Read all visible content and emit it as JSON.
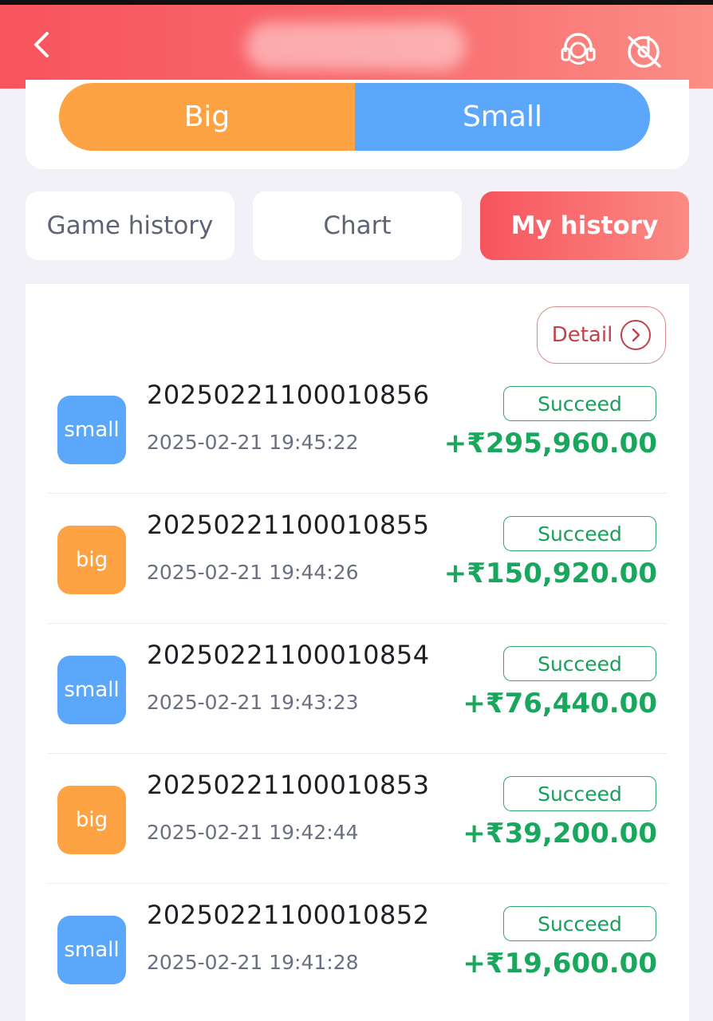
{
  "header": {
    "back_icon": "chevron-left-icon",
    "logo_text": "",
    "support_icon": "headset-icon",
    "sound_icon": "sound-off-icon"
  },
  "bet_toggle": {
    "big_label": "Big",
    "small_label": "Small",
    "big_color": "#fea343",
    "small_color": "#5aa7fb"
  },
  "tabs": [
    {
      "label": "Game history",
      "active": false
    },
    {
      "label": "Chart",
      "active": false
    },
    {
      "label": "My history",
      "active": true
    }
  ],
  "detail_label": "Detail",
  "history": [
    {
      "bet": "small",
      "issue": "20250221100010856",
      "time": "2025-02-21 19:45:22",
      "status": "Succeed",
      "amount": "+₹295,960.00"
    },
    {
      "bet": "big",
      "issue": "20250221100010855",
      "time": "2025-02-21 19:44:26",
      "status": "Succeed",
      "amount": "+₹150,920.00"
    },
    {
      "bet": "small",
      "issue": "20250221100010854",
      "time": "2025-02-21 19:43:23",
      "status": "Succeed",
      "amount": "+₹76,440.00"
    },
    {
      "bet": "big",
      "issue": "20250221100010853",
      "time": "2025-02-21 19:42:44",
      "status": "Succeed",
      "amount": "+₹39,200.00"
    },
    {
      "bet": "small",
      "issue": "20250221100010852",
      "time": "2025-02-21 19:41:28",
      "status": "Succeed",
      "amount": "+₹19,600.00"
    }
  ],
  "colors": {
    "accent": "#f7545e",
    "success": "#19a65d"
  }
}
